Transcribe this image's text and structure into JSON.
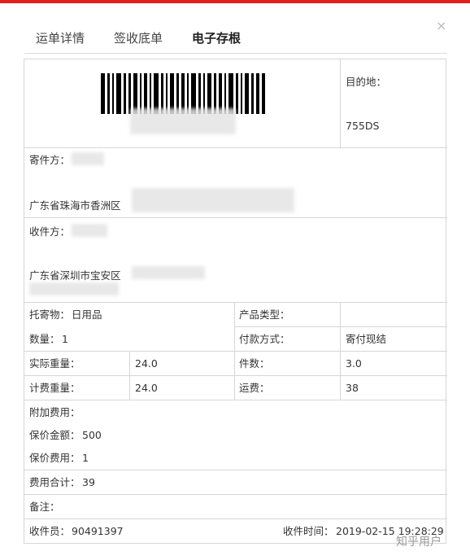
{
  "tabs": {
    "waybill_details": "运单详情",
    "receipt_bottom": "签收底单",
    "electronic_stub": "电子存根"
  },
  "close_symbol": "×",
  "destination": {
    "label": "目的地：",
    "value": "755DS"
  },
  "sender": {
    "label": "寄件方：",
    "address": "广东省珠海市香洲区"
  },
  "receiver": {
    "label": "收件方：",
    "address": "广东省深圳市宝安区"
  },
  "goods": {
    "label": "托寄物：",
    "value": "日用品"
  },
  "product_type": {
    "label": "产品类型：",
    "value": ""
  },
  "quantity": {
    "label": "数量：",
    "value": "1"
  },
  "payment": {
    "label": "付款方式：",
    "value": "寄付现结"
  },
  "actual_weight": {
    "label": "实际重量：",
    "value": "24.0"
  },
  "pieces": {
    "label": "件数：",
    "value": "3.0"
  },
  "billed_weight": {
    "label": "计费重量：",
    "value": "24.0"
  },
  "freight": {
    "label": "运费：",
    "value": "38"
  },
  "extra_fees": {
    "label": "附加费用："
  },
  "insured_amount": {
    "label": "保价金额：",
    "value": "500"
  },
  "insurance_fee": {
    "label": "保价费用：",
    "value": "1"
  },
  "fee_total": {
    "label": "费用合计：",
    "value": "39"
  },
  "remarks": {
    "label": "备注：",
    "value": ""
  },
  "collector": {
    "label": "收件员：",
    "value": "90491397"
  },
  "pickup_time": {
    "label": "收件时间：",
    "value": "2019-02-15 19:28:29"
  },
  "watermark": "知乎用户"
}
